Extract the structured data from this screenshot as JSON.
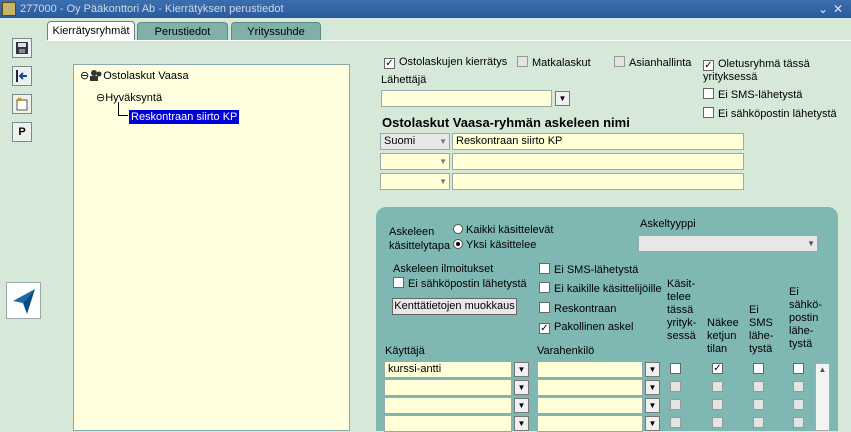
{
  "window": {
    "title": "277000 - Oy Pääkonttori Ab - Kierrätyksen perustiedot",
    "minimize_glyph": "⌄",
    "close_glyph": "✕"
  },
  "toolbar": {
    "save_icon": "floppy-icon",
    "exit_icon": "exit-icon",
    "new_icon": "new-icon",
    "p_label": "P"
  },
  "tabs": [
    {
      "label": "Kierrätysryhmät",
      "active": true
    },
    {
      "label": "Perustiedot",
      "active": false
    },
    {
      "label": "Yrityssuhde",
      "active": false
    }
  ],
  "tree": {
    "root": "Ostolaskut Vaasa",
    "child": "Hyväksyntä",
    "leaf": "Reskontraan siirto KP"
  },
  "top_checks": {
    "ostolaskut": {
      "label": "Ostolaskujen kierrätys",
      "checked": true
    },
    "matkalaskut": {
      "label": "Matkalaskut",
      "checked": false
    },
    "asianhallinta": {
      "label": "Asianhallinta",
      "checked": false
    },
    "oletus": {
      "label": "Oletusryhmä tässä yrityksessä",
      "checked": true
    },
    "ei_sms": {
      "label": "Ei SMS-lähetystä",
      "checked": false
    },
    "ei_sahkoposti": {
      "label": "Ei sähköpostin lähetystä",
      "checked": false
    }
  },
  "lahettaja": {
    "label": "Lähettäjä",
    "value": ""
  },
  "step_name": {
    "heading": "Ostolaskut Vaasa-ryhmän askeleen nimi",
    "rows": [
      {
        "lang": "Suomi",
        "name": "Reskontraan siirto KP"
      },
      {
        "lang": "",
        "name": ""
      },
      {
        "lang": "",
        "name": ""
      }
    ]
  },
  "step": {
    "kasittelytapa_label_1": "Askeleen",
    "kasittelytapa_label_2": "käsittelytapa",
    "radio_all": "Kaikki käsittelevät",
    "radio_one": "Yksi käsittelee",
    "askeltyyppi_label": "Askeltyyppi",
    "askeltyyppi_value": "",
    "ilmoitukset_label": "Askeleen ilmoitukset",
    "ei_sahkoposti": "Ei sähköpostin lähetystä",
    "ei_sms": "Ei SMS-lähetystä",
    "ei_kaikille": "Ei kaikille käsittelijöille",
    "reskontraan": "Reskontraan",
    "pakollinen": "Pakollinen askel",
    "kentta_button": "Kenttätietojen muokkaus"
  },
  "grid": {
    "kayttaja_label": "Käyttäjä",
    "varahenkilo_label": "Varahenkilö",
    "col1": [
      "Käsit-",
      "telee",
      "tässä",
      "yrityk-",
      "sessä"
    ],
    "col2": [
      "Näkee",
      "ketjun",
      "tilan"
    ],
    "col3": [
      "Ei",
      "SMS",
      "lähe-",
      "tystä"
    ],
    "col4": [
      "Ei",
      "sähkö-",
      "postin",
      "lähe-",
      "tystä"
    ],
    "rows": [
      {
        "user": "kurssi-antti",
        "deputy": "",
        "c1": false,
        "c2": true,
        "c3": false,
        "c4": false
      },
      {
        "user": "",
        "deputy": "",
        "c1": false,
        "c2": false,
        "c3": false,
        "c4": false
      },
      {
        "user": "",
        "deputy": "",
        "c1": false,
        "c2": false,
        "c3": false,
        "c4": false
      },
      {
        "user": "",
        "deputy": "",
        "c1": false,
        "c2": false,
        "c3": false,
        "c4": false
      }
    ]
  }
}
